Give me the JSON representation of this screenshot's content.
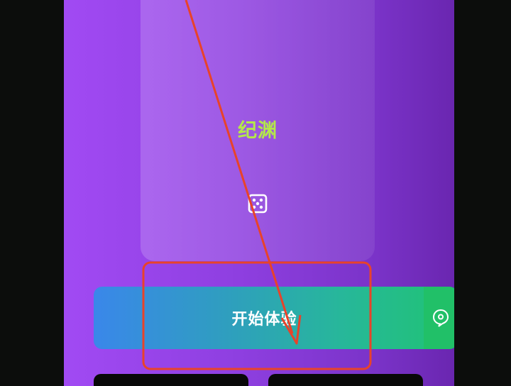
{
  "card": {
    "title": "纪渊",
    "icon": "dice-icon"
  },
  "start_button": {
    "label": "开始体验"
  },
  "side_button": {
    "icon": "chat-location-icon"
  },
  "colors": {
    "card_title": "#b4e84a",
    "annotation": "#e8432a",
    "accent_green": "#21c068"
  }
}
